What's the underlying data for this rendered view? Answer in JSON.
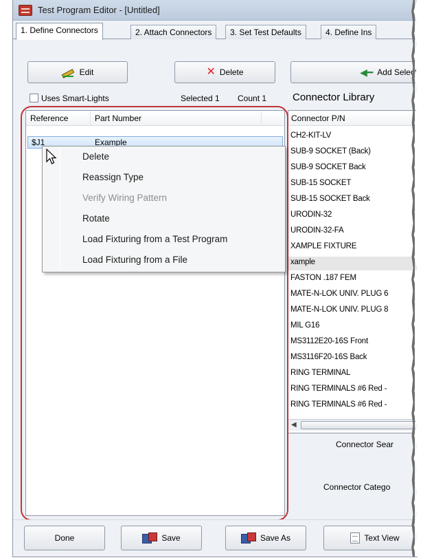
{
  "window": {
    "title": "Test Program Editor - [Untitled]"
  },
  "tabs": [
    {
      "label": "1. Define Connectors",
      "active": true
    },
    {
      "label": "2. Attach Connectors",
      "active": false
    },
    {
      "label": "3. Set Test Defaults",
      "active": false
    },
    {
      "label": "4. Define Ins",
      "active": false
    }
  ],
  "toolbar": {
    "edit_label": "Edit",
    "delete_label": "Delete",
    "add_selected_label": "Add Selecte",
    "smart_lights_label": "Uses Smart-Lights",
    "smart_lights_checked": false,
    "selected_text": "Selected 1",
    "count_text": "Count 1"
  },
  "connector_list": {
    "columns": [
      "Reference",
      "Part Number"
    ],
    "rows": [
      {
        "reference": "$J1",
        "part_number": "Example",
        "selected": true
      }
    ]
  },
  "context_menu": {
    "items": [
      {
        "label": "Delete",
        "enabled": true
      },
      {
        "label": "Reassign Type",
        "enabled": true
      },
      {
        "label": "Verify Wiring Pattern",
        "enabled": false
      },
      {
        "label": "Rotate",
        "enabled": true
      },
      {
        "label": "Load Fixturing from a Test Program",
        "enabled": true
      },
      {
        "label": "Load Fixturing from a File",
        "enabled": true
      }
    ]
  },
  "library": {
    "title": "Connector Library",
    "column": "Connector P/N",
    "items": [
      "CH2-KIT-LV",
      "SUB-9 SOCKET (Back)",
      "SUB-9 SOCKET Back",
      "SUB-15 SOCKET",
      "SUB-15 SOCKET Back",
      "URODIN-32",
      "URODIN-32-FA",
      "XAMPLE FIXTURE",
      "xample",
      "FASTON .187 FEM",
      "MATE-N-LOK UNIV. PLUG 6",
      "MATE-N-LOK UNIV. PLUG 8",
      "MIL G16",
      "MS3112E20-16S Front",
      "MS3116F20-16S Back",
      "RING TERMINAL",
      "RING TERMINALS #6 Red -",
      "RING TERMINALS #6 Red -"
    ],
    "selected_index": 8,
    "search_label": "Connector Sear",
    "category_label": "Connector Catego"
  },
  "bottom": {
    "done_label": "Done",
    "save_label": "Save",
    "save_as_label": "Save As",
    "text_view_label": "Text View"
  },
  "icons": {
    "edit": "pencil-icon",
    "delete": "x-icon",
    "add": "arrow-left-icon",
    "save": "save-icon",
    "text_view": "document-icon"
  },
  "colors": {
    "highlight_border": "#c0343a",
    "title_bar": "#c9d7e8",
    "delete_x": "#e02020"
  }
}
